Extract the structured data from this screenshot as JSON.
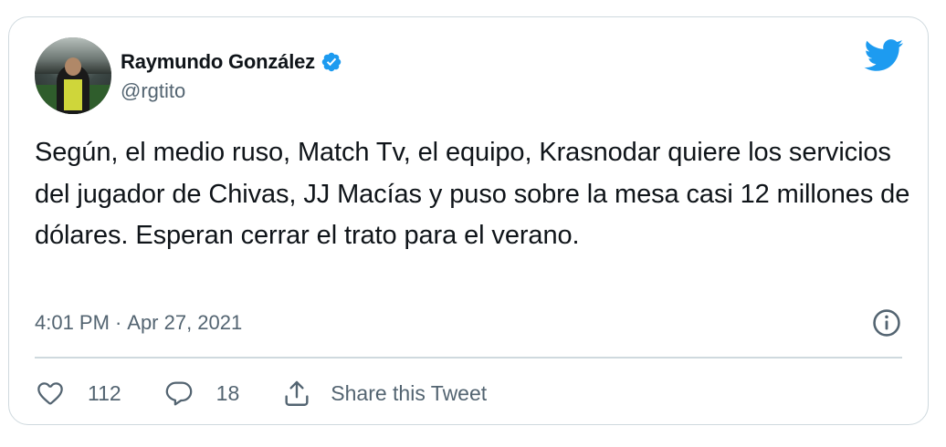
{
  "tweet": {
    "author": {
      "name": "Raymundo González",
      "handle": "@rgtito",
      "verified": true
    },
    "text": "Según, el medio ruso, Match Tv, el equipo, Krasnodar quiere los servicios del jugador de Chivas, JJ Macías y puso sobre la mesa casi 12 millones de dólares. Esperan cerrar el trato para el verano.",
    "time": "4:01 PM",
    "separator": "·",
    "date": "Apr 27, 2021",
    "likes": "112",
    "replies": "18",
    "share_label": "Share this Tweet"
  },
  "icons": {
    "brand": "twitter-bird-icon",
    "verified": "verified-badge-icon",
    "info": "info-icon",
    "like": "heart-icon",
    "reply": "reply-bubble-icon",
    "share": "share-icon"
  },
  "colors": {
    "brand_blue": "#1d9bf0",
    "text_primary": "#0f1419",
    "text_secondary": "#536471",
    "border": "#cfd9de"
  }
}
